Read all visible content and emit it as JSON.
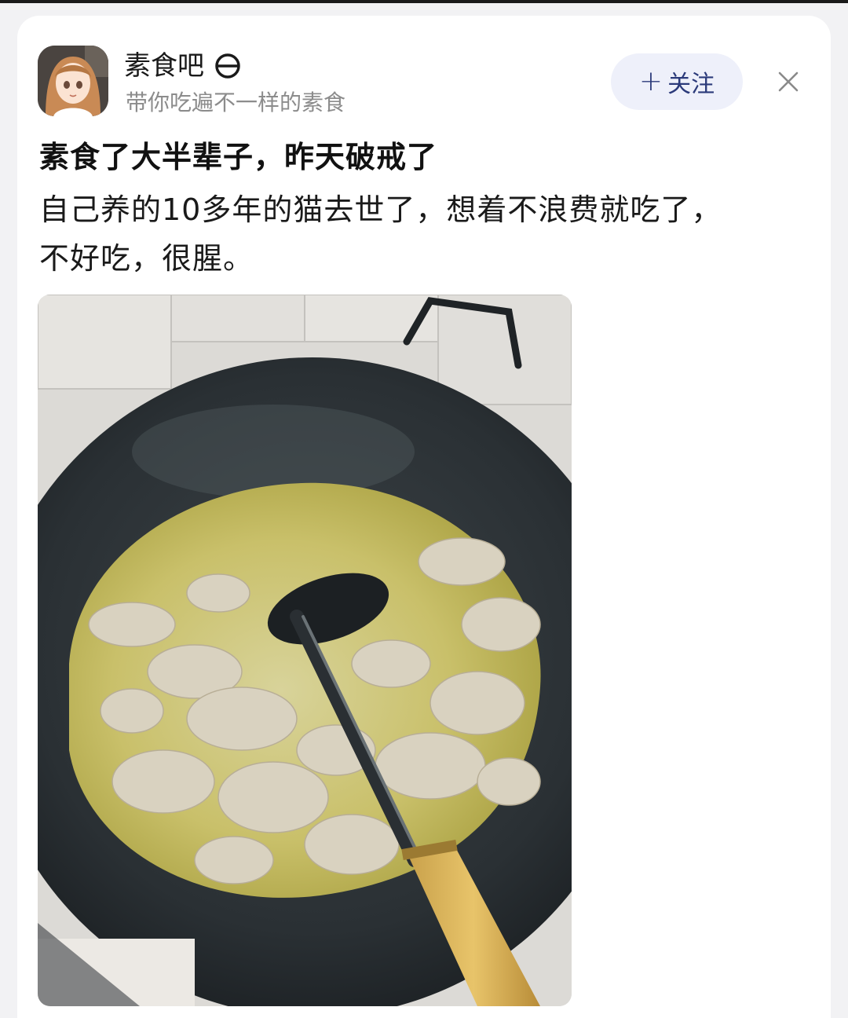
{
  "account": {
    "name": "素食吧",
    "description": "带你吃遍不一样的素食",
    "follow_label": "关注"
  },
  "post": {
    "title": "素食了大半辈子，昨天破戒了",
    "body_lines": [
      "自己养的10多年的猫去世了，想着不浪费就吃了，",
      "不好吃，很腥。"
    ]
  },
  "icons": {
    "badge": "circle-slash-badge-icon",
    "follow": "plus-icon",
    "close": "close-icon"
  },
  "colors": {
    "follow_button_bg": "#eef0fa",
    "follow_button_text": "#2b3a7a",
    "secondary_text": "#8c8c8c"
  }
}
